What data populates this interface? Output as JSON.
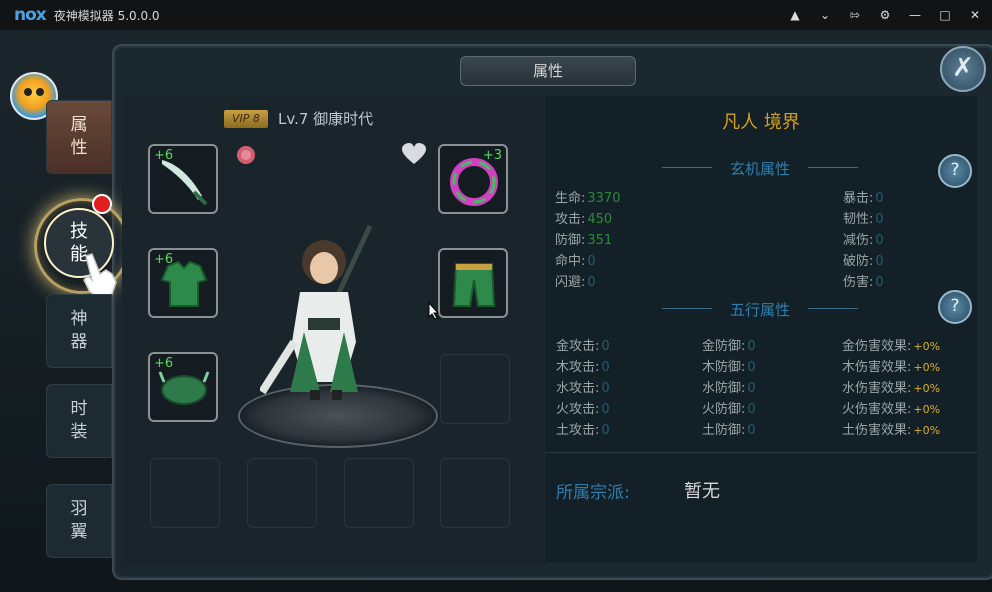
{
  "titlebar": {
    "logo": "nox",
    "title": "夜神模拟器 5.0.0.0",
    "controls": [
      "shirt-icon",
      "chevron-down-icon",
      "pin-icon",
      "gear-icon",
      "minimize-icon",
      "maximize-icon",
      "close-icon"
    ]
  },
  "panel": {
    "title": "属性",
    "close_icon": "sword-icon"
  },
  "left_tabs": [
    {
      "label": "属\n性",
      "active": true
    },
    {
      "label": "技\n能",
      "active": false,
      "badge": true
    },
    {
      "label": "神\n器",
      "active": false
    },
    {
      "label": "时\n装",
      "active": false
    },
    {
      "label": "羽\n翼",
      "active": false
    }
  ],
  "character": {
    "vip": "VIP 8",
    "level_name": "Lv.7  御康时代"
  },
  "equipment": {
    "left": [
      {
        "plus": "+6",
        "icon": "sword-icon"
      },
      {
        "plus": "+6",
        "icon": "armor-icon"
      },
      {
        "plus": "+6",
        "icon": "helmet-icon"
      }
    ],
    "right": [
      {
        "plus": "+3",
        "icon": "ring-icon"
      },
      {
        "plus": "",
        "icon": "pants-icon"
      }
    ]
  },
  "stats": {
    "realm": "凡人 境界",
    "section1": "玄机属性",
    "basic_left": [
      {
        "label": "生命:",
        "value": "3370"
      },
      {
        "label": "攻击:",
        "value": "450"
      },
      {
        "label": "防御:",
        "value": "351"
      },
      {
        "label": "命中:",
        "value": "0"
      },
      {
        "label": "闪避:",
        "value": "0"
      }
    ],
    "basic_right": [
      {
        "label": "暴击:",
        "value": "0"
      },
      {
        "label": "韧性:",
        "value": "0"
      },
      {
        "label": "减伤:",
        "value": "0"
      },
      {
        "label": "破防:",
        "value": "0"
      },
      {
        "label": "伤害:",
        "value": "0"
      }
    ],
    "section2": "五行属性",
    "element_atk": [
      {
        "label": "金攻击:",
        "value": "0"
      },
      {
        "label": "木攻击:",
        "value": "0"
      },
      {
        "label": "水攻击:",
        "value": "0"
      },
      {
        "label": "火攻击:",
        "value": "0"
      },
      {
        "label": "土攻击:",
        "value": "0"
      }
    ],
    "element_def": [
      {
        "label": "金防御:",
        "value": "0"
      },
      {
        "label": "木防御:",
        "value": "0"
      },
      {
        "label": "水防御:",
        "value": "0"
      },
      {
        "label": "火防御:",
        "value": "0"
      },
      {
        "label": "土防御:",
        "value": "0"
      }
    ],
    "element_dmg": [
      {
        "label": "金伤害效果:",
        "value": "+0%"
      },
      {
        "label": "木伤害效果:",
        "value": "+0%"
      },
      {
        "label": "水伤害效果:",
        "value": "+0%"
      },
      {
        "label": "火伤害效果:",
        "value": "+0%"
      },
      {
        "label": "土伤害效果:",
        "value": "+0%"
      }
    ],
    "help": "?"
  },
  "sect": {
    "label": "所属宗派:",
    "value": "暂无"
  }
}
